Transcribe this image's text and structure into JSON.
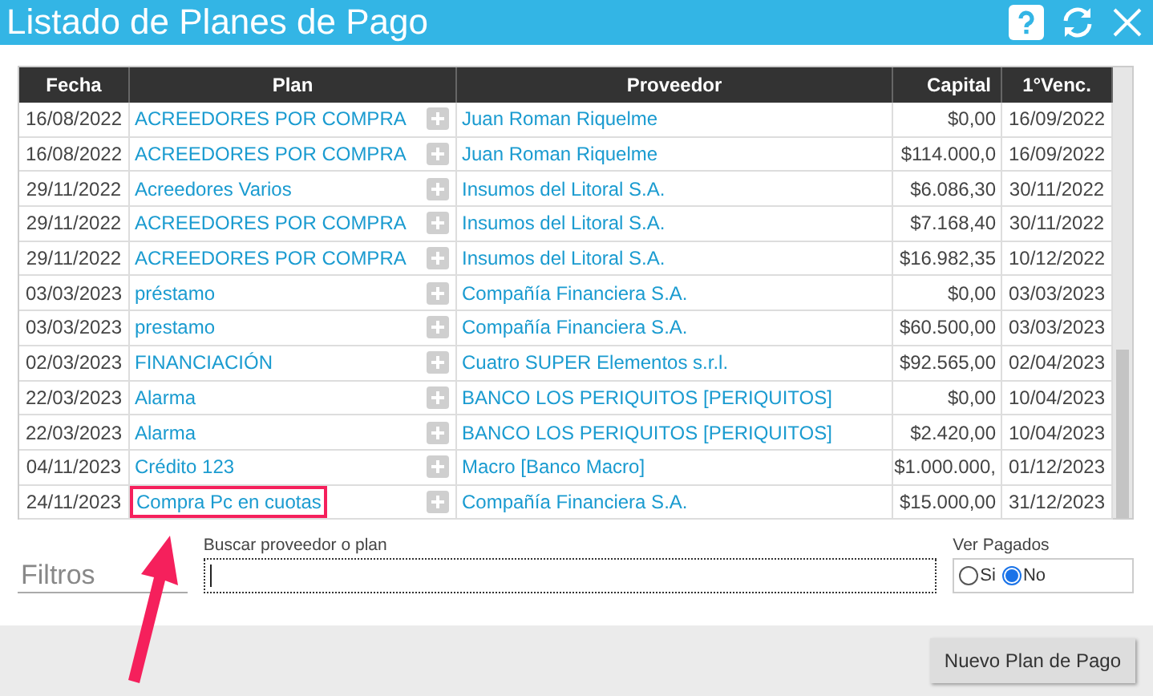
{
  "window": {
    "title": "Listado de Planes de Pago"
  },
  "table": {
    "columns": [
      "Fecha",
      "Plan",
      "Proveedor",
      "Capital",
      "1°Venc."
    ],
    "rows": [
      {
        "fecha": "16/08/2022",
        "plan": "ACREEDORES POR COMPRA",
        "proveedor": "Juan Roman Riquelme",
        "capital": "$0,00",
        "venc": "16/09/2022",
        "highlighted": false
      },
      {
        "fecha": "16/08/2022",
        "plan": "ACREEDORES POR COMPRA",
        "proveedor": "Juan Roman Riquelme",
        "capital": "$114.000,0",
        "venc": "16/09/2022",
        "highlighted": false
      },
      {
        "fecha": "29/11/2022",
        "plan": "Acreedores Varios",
        "proveedor": "Insumos del Litoral S.A.",
        "capital": "$6.086,30",
        "venc": "30/11/2022",
        "highlighted": false
      },
      {
        "fecha": "29/11/2022",
        "plan": "ACREEDORES POR COMPRA",
        "proveedor": "Insumos del Litoral S.A.",
        "capital": "$7.168,40",
        "venc": "30/11/2022",
        "highlighted": false
      },
      {
        "fecha": "29/11/2022",
        "plan": "ACREEDORES POR COMPRA",
        "proveedor": "Insumos del Litoral S.A.",
        "capital": "$16.982,35",
        "venc": "10/12/2022",
        "highlighted": false
      },
      {
        "fecha": "03/03/2023",
        "plan": "préstamo",
        "proveedor": "Compañía Financiera S.A.",
        "capital": "$0,00",
        "venc": "03/03/2023",
        "highlighted": false
      },
      {
        "fecha": "03/03/2023",
        "plan": "prestamo",
        "proveedor": "Compañía Financiera S.A.",
        "capital": "$60.500,00",
        "venc": "03/03/2023",
        "highlighted": false
      },
      {
        "fecha": "02/03/2023",
        "plan": "FINANCIACIÓN",
        "proveedor": "Cuatro SUPER Elementos s.r.l.",
        "capital": "$92.565,00",
        "venc": "02/04/2023",
        "highlighted": false
      },
      {
        "fecha": "22/03/2023",
        "plan": "Alarma",
        "proveedor": "BANCO LOS PERIQUITOS [PERIQUITOS]",
        "capital": "$0,00",
        "venc": "10/04/2023",
        "highlighted": false
      },
      {
        "fecha": "22/03/2023",
        "plan": "Alarma",
        "proveedor": "BANCO LOS PERIQUITOS [PERIQUITOS]",
        "capital": "$2.420,00",
        "venc": "10/04/2023",
        "highlighted": false
      },
      {
        "fecha": "04/11/2023",
        "plan": "Crédito 123",
        "proveedor": "Macro [Banco Macro]",
        "capital": "$1.000.000,",
        "venc": "01/12/2023",
        "highlighted": false
      },
      {
        "fecha": "24/11/2023",
        "plan": "Compra Pc en cuotas",
        "proveedor": "Compañía Financiera S.A.",
        "capital": "$15.000,00",
        "venc": "31/12/2023",
        "highlighted": true
      }
    ]
  },
  "filters": {
    "title": "Filtros",
    "search": {
      "label": "Buscar proveedor o plan"
    },
    "ver_pagados": {
      "label": "Ver Pagados",
      "options": [
        {
          "label": "Si",
          "selected": false
        },
        {
          "label": "No",
          "selected": true
        }
      ]
    }
  },
  "buttons": [
    "Nuevo Plan de Pago"
  ]
}
